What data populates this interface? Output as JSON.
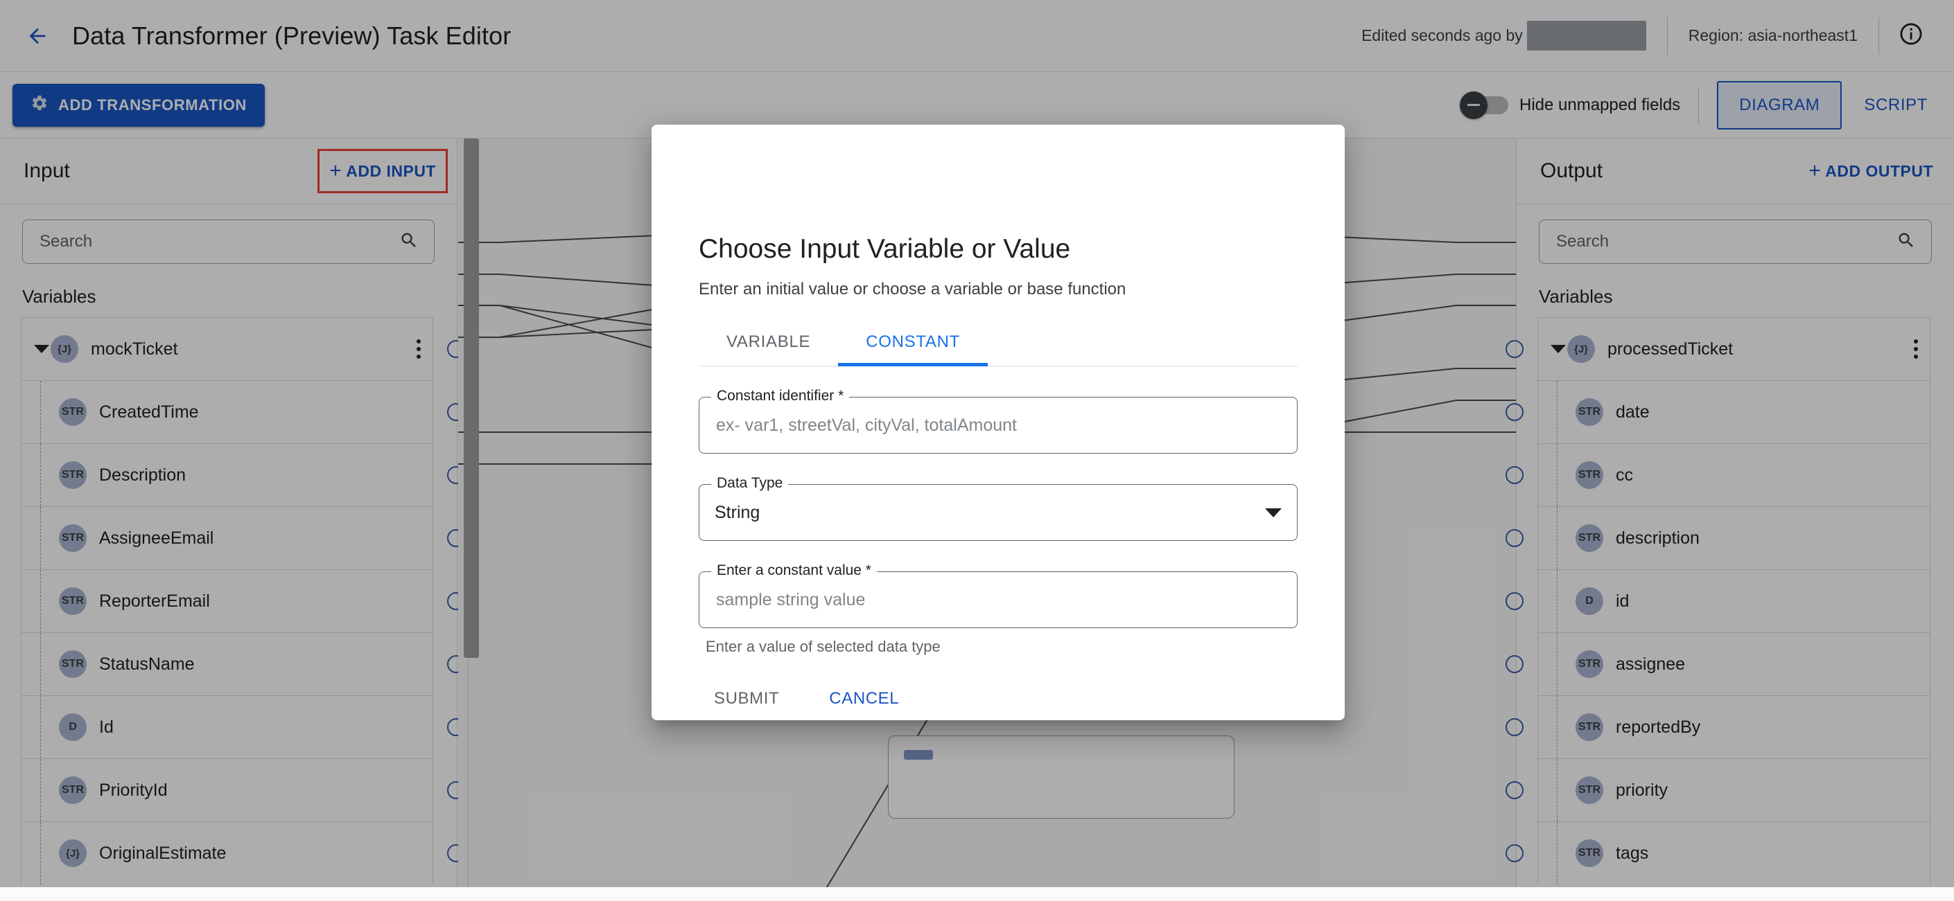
{
  "header": {
    "back_icon": "arrow-left-icon",
    "title": "Data Transformer (Preview) Task Editor",
    "edited_text": "Edited seconds ago by",
    "region_text": "Region: asia-northeast1",
    "info_icon": "info-circle-icon"
  },
  "toolbar": {
    "add_transformation_label": "ADD TRANSFORMATION",
    "gear_icon": "gear-icon",
    "toggle_label": "Hide unmapped fields",
    "toggle_state": "off",
    "tabs": [
      {
        "label": "DIAGRAM",
        "active": true
      },
      {
        "label": "SCRIPT",
        "active": false
      }
    ]
  },
  "input_panel": {
    "title": "Input",
    "add_label": "ADD INPUT",
    "search_placeholder": "Search",
    "search_value": "",
    "search_icon": "search-icon",
    "section_label": "Variables",
    "root": {
      "type": "{J}",
      "name": "mockTicket"
    },
    "fields": [
      {
        "type": "STR",
        "name": "CreatedTime"
      },
      {
        "type": "STR",
        "name": "Description"
      },
      {
        "type": "STR",
        "name": "AssigneeEmail"
      },
      {
        "type": "STR",
        "name": "ReporterEmail"
      },
      {
        "type": "STR",
        "name": "StatusName"
      },
      {
        "type": "D",
        "name": "Id"
      },
      {
        "type": "STR",
        "name": "PriorityId"
      },
      {
        "type": "{J}",
        "name": "OriginalEstimate"
      }
    ]
  },
  "output_panel": {
    "title": "Output",
    "add_label": "ADD OUTPUT",
    "search_placeholder": "Search",
    "search_value": "",
    "search_icon": "search-icon",
    "section_label": "Variables",
    "root": {
      "type": "{J}",
      "name": "processedTicket"
    },
    "fields": [
      {
        "type": "STR",
        "name": "date"
      },
      {
        "type": "STR",
        "name": "cc"
      },
      {
        "type": "STR",
        "name": "description"
      },
      {
        "type": "D",
        "name": "id"
      },
      {
        "type": "STR",
        "name": "assignee"
      },
      {
        "type": "STR",
        "name": "reportedBy"
      },
      {
        "type": "STR",
        "name": "priority"
      },
      {
        "type": "STR",
        "name": "tags"
      }
    ]
  },
  "dialog": {
    "title": "Choose Input Variable or Value",
    "subtitle": "Enter an initial value or choose a variable or base function",
    "tabs": [
      {
        "label": "VARIABLE",
        "active": false
      },
      {
        "label": "CONSTANT",
        "active": true
      }
    ],
    "identifier_label": "Constant identifier *",
    "identifier_placeholder": "ex- var1, streetVal, cityVal, totalAmount",
    "identifier_value": "",
    "datatype_label": "Data Type",
    "datatype_value": "String",
    "datatype_caret_icon": "chevron-down-icon",
    "value_label": "Enter a constant value *",
    "value_placeholder": "sample string value",
    "value_value": "",
    "value_hint": "Enter a value of selected data type",
    "submit_label": "SUBMIT",
    "cancel_label": "CANCEL"
  },
  "colors": {
    "accent_blue": "#1a56c4",
    "link_blue": "#1a73e8",
    "highlight_red": "#ea4335",
    "port_blue": "#3b5ca8",
    "chip_lavender": "#aab4d2"
  }
}
